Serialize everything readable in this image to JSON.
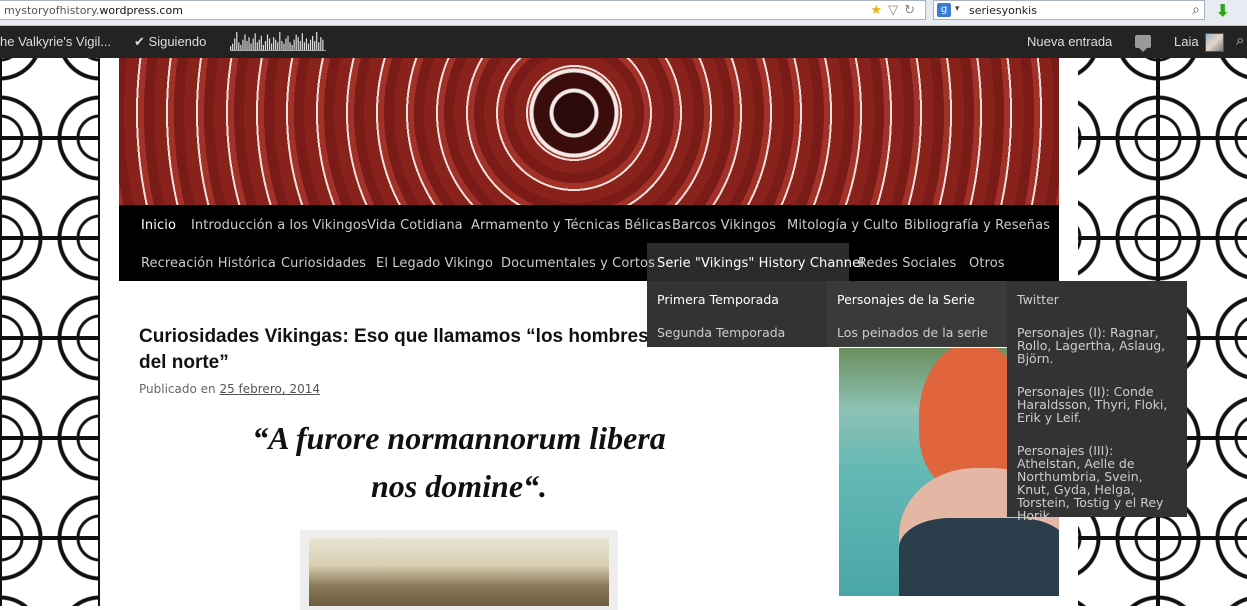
{
  "browser": {
    "url_prefix": "mystoryofhistory.",
    "url_domain": "wordpress.com",
    "search_engine_label": "g",
    "search_query": "seriesyonkis",
    "icons": [
      "star-icon",
      "dropmarker-icon",
      "reload-icon",
      "search-icon",
      "download-icon"
    ]
  },
  "adminbar": {
    "site_name": "he Valkyrie's Vigil...",
    "following": "Siguiendo",
    "new_post": "Nueva entrada",
    "user": "Laia",
    "stats_bars": [
      3,
      5,
      9,
      14,
      6,
      4,
      8,
      12,
      7,
      10,
      5,
      9,
      13,
      6,
      8,
      11,
      4,
      7,
      12,
      9,
      5,
      10,
      8,
      6,
      14,
      7,
      5,
      9,
      11,
      6,
      4,
      8,
      12,
      10,
      7,
      13,
      6,
      9,
      5,
      8,
      11,
      7,
      14,
      6,
      10,
      8
    ]
  },
  "nav": {
    "row1": [
      "Inicio",
      "Introducción a los Vikingos",
      "Vida Cotidiana",
      "Armamento y Técnicas Bélicas",
      "Barcos Vikingos",
      "Mitología y Culto",
      "Bibliografía y Reseñas"
    ],
    "row2": [
      "Recreación Histórica",
      "Curiosidades",
      "El Legado Vikingo",
      "Documentales y Cortos",
      "Serie \"Vikings\" History Channel",
      "Redes Sociales",
      "Otros"
    ]
  },
  "dropdown": {
    "level1": [
      "Primera Temporada",
      "Segunda Temporada"
    ],
    "level2": [
      "Personajes de la Serie",
      "Los peinados de la serie"
    ],
    "level3": [
      "Twitter",
      "Personajes (I): Ragnar, Rollo, Lagertha, Aslaug, Björn.",
      "Personajes (II): Conde Haraldsson, Thyri, Floki, Erik y Leif.",
      "Personajes (III): Athelstan, Aelle de Northumbria, Svein, Knut, Gyda, Helga, Torstein, Tostig y el Rey Horik."
    ]
  },
  "post": {
    "title": "Curiosidades Vikingas: Eso que llamamos “los hombres del norte”",
    "meta_prefix": "Publicado en ",
    "date": "25 febrero, 2014",
    "quote_line1": "“A furore normannorum libera",
    "quote_line2": "nos domine“."
  }
}
